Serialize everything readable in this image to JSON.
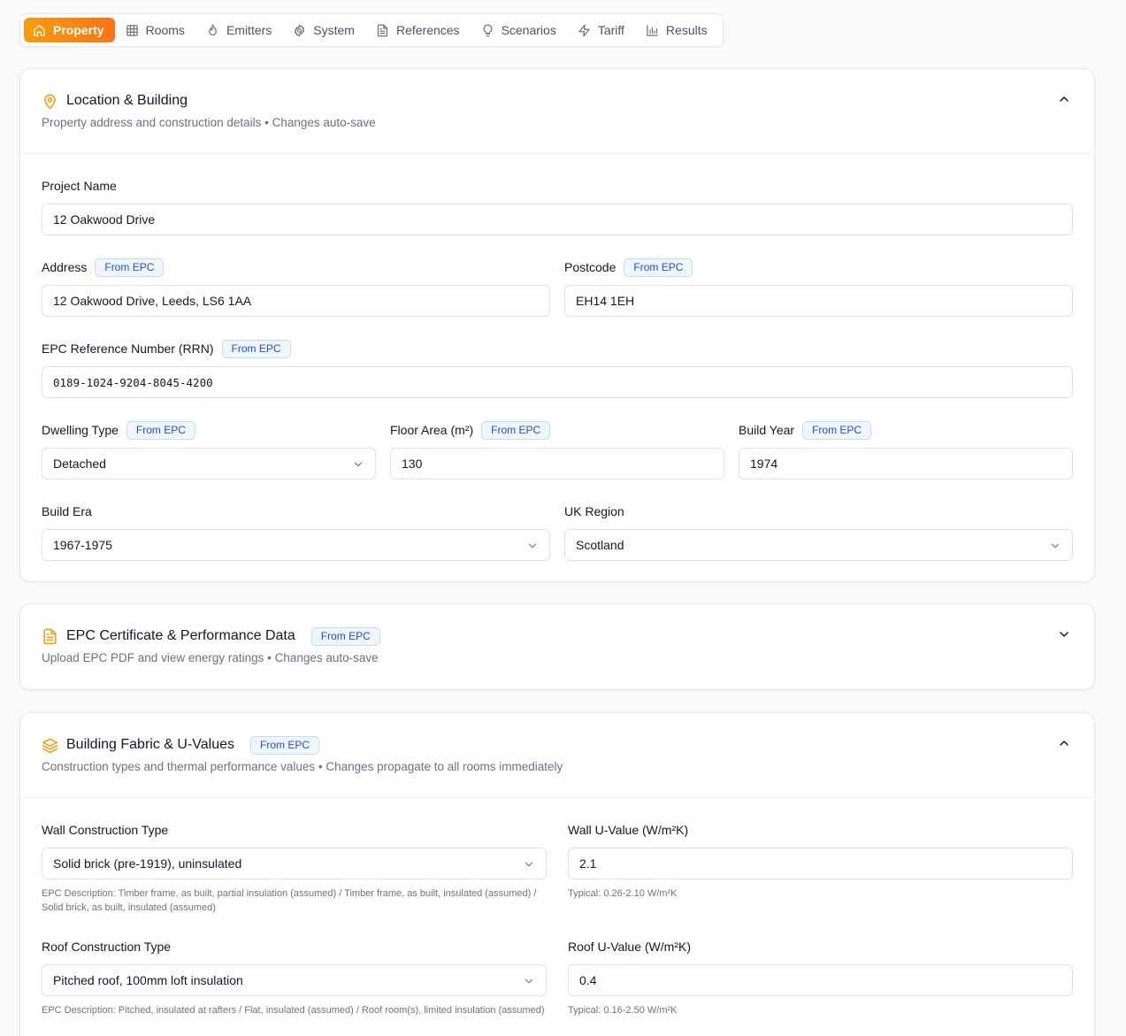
{
  "tabs": [
    {
      "label": "Property",
      "icon": "home-icon",
      "active": true
    },
    {
      "label": "Rooms",
      "icon": "grid-icon"
    },
    {
      "label": "Emitters",
      "icon": "flame-icon"
    },
    {
      "label": "System",
      "icon": "gear-icon"
    },
    {
      "label": "References",
      "icon": "document-icon"
    },
    {
      "label": "Scenarios",
      "icon": "lightbulb-icon"
    },
    {
      "label": "Tariff",
      "icon": "lightning-icon"
    },
    {
      "label": "Results",
      "icon": "bar-chart-icon"
    }
  ],
  "colors": {
    "accent_start": "#f59e0b",
    "accent_end": "#f97316",
    "badge_blue": "#1d4ed8"
  },
  "location": {
    "title": "Location & Building",
    "subtitle": "Property address and construction details • Changes auto-save",
    "expanded": true,
    "project_name": {
      "label": "Project Name",
      "value": "12 Oakwood Drive"
    },
    "address": {
      "label": "Address",
      "badge": "From EPC",
      "value": "12 Oakwood Drive, Leeds, LS6 1AA"
    },
    "postcode": {
      "label": "Postcode",
      "badge": "From EPC",
      "value": "EH14 1EH"
    },
    "epc_rrn": {
      "label": "EPC Reference Number (RRN)",
      "badge": "From EPC",
      "value": "0189-1024-9204-8045-4200"
    },
    "dwelling_type": {
      "label": "Dwelling Type",
      "badge": "From EPC",
      "value": "Detached"
    },
    "floor_area": {
      "label": "Floor Area (m²)",
      "badge": "From EPC",
      "value": "130"
    },
    "build_year": {
      "label": "Build Year",
      "badge": "From EPC",
      "value": "1974"
    },
    "build_era": {
      "label": "Build Era",
      "value": "1967-1975"
    },
    "uk_region": {
      "label": "UK Region",
      "value": "Scotland"
    }
  },
  "epc": {
    "title": "EPC Certificate & Performance Data",
    "badge": "From EPC",
    "subtitle": "Upload EPC PDF and view energy ratings • Changes auto-save",
    "expanded": false
  },
  "fabric": {
    "title": "Building Fabric & U-Values",
    "badge": "From EPC",
    "subtitle": "Construction types and thermal performance values • Changes propagate to all rooms immediately",
    "expanded": true,
    "wall_type": {
      "label": "Wall Construction Type",
      "value": "Solid brick (pre-1919), uninsulated",
      "hint": "EPC Description: Timber frame, as built, partial insulation (assumed) / Timber frame, as built, insulated (assumed) / Solid brick, as built, insulated (assumed)"
    },
    "wall_u": {
      "label": "Wall U-Value (W/m²K)",
      "value": "2.1",
      "hint": "Typical: 0.26-2.10 W/m²K"
    },
    "roof_type": {
      "label": "Roof Construction Type",
      "value": "Pitched roof, 100mm loft insulation",
      "hint": "EPC Description: Pitched, insulated at rafters / Flat, insulated (assumed) / Roof room(s), limited insulation (assumed)"
    },
    "roof_u": {
      "label": "Roof U-Value (W/m²K)",
      "value": "0.4",
      "hint": "Typical: 0.16-2.50 W/m²K"
    }
  }
}
